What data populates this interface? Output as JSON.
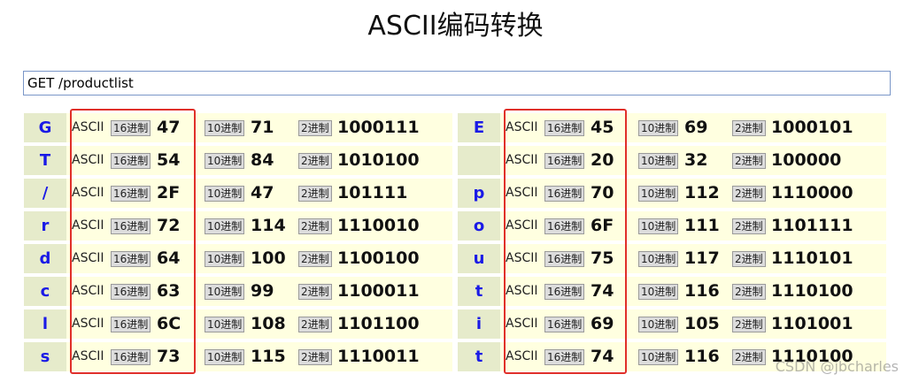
{
  "title": "ASCII编码转换",
  "input": {
    "value": "GET /productlist"
  },
  "labels": {
    "ascii": "ASCII",
    "hex": "16进制",
    "dec": "10进制",
    "bin": "2进制"
  },
  "left_rows": [
    {
      "char": "G",
      "hex": "47",
      "dec": "71",
      "bin": "1000111"
    },
    {
      "char": "T",
      "hex": "54",
      "dec": "84",
      "bin": "1010100"
    },
    {
      "char": "/",
      "hex": "2F",
      "dec": "47",
      "bin": "101111"
    },
    {
      "char": "r",
      "hex": "72",
      "dec": "114",
      "bin": "1110010"
    },
    {
      "char": "d",
      "hex": "64",
      "dec": "100",
      "bin": "1100100"
    },
    {
      "char": "c",
      "hex": "63",
      "dec": "99",
      "bin": "1100011"
    },
    {
      "char": "l",
      "hex": "6C",
      "dec": "108",
      "bin": "1101100"
    },
    {
      "char": "s",
      "hex": "73",
      "dec": "115",
      "bin": "1110011"
    }
  ],
  "right_rows": [
    {
      "char": "E",
      "hex": "45",
      "dec": "69",
      "bin": "1000101"
    },
    {
      "char": "",
      "hex": "20",
      "dec": "32",
      "bin": "100000"
    },
    {
      "char": "p",
      "hex": "70",
      "dec": "112",
      "bin": "1110000"
    },
    {
      "char": "o",
      "hex": "6F",
      "dec": "111",
      "bin": "1101111"
    },
    {
      "char": "u",
      "hex": "75",
      "dec": "117",
      "bin": "1110101"
    },
    {
      "char": "t",
      "hex": "74",
      "dec": "116",
      "bin": "1110100"
    },
    {
      "char": "i",
      "hex": "69",
      "dec": "105",
      "bin": "1101001"
    },
    {
      "char": "t",
      "hex": "74",
      "dec": "116",
      "bin": "1110100"
    }
  ],
  "watermark": "CSDN @jbcharles",
  "colors": {
    "char_text": "#1a1ae6",
    "row_bg": "#ffffe0",
    "highlight": "#e0302a"
  }
}
